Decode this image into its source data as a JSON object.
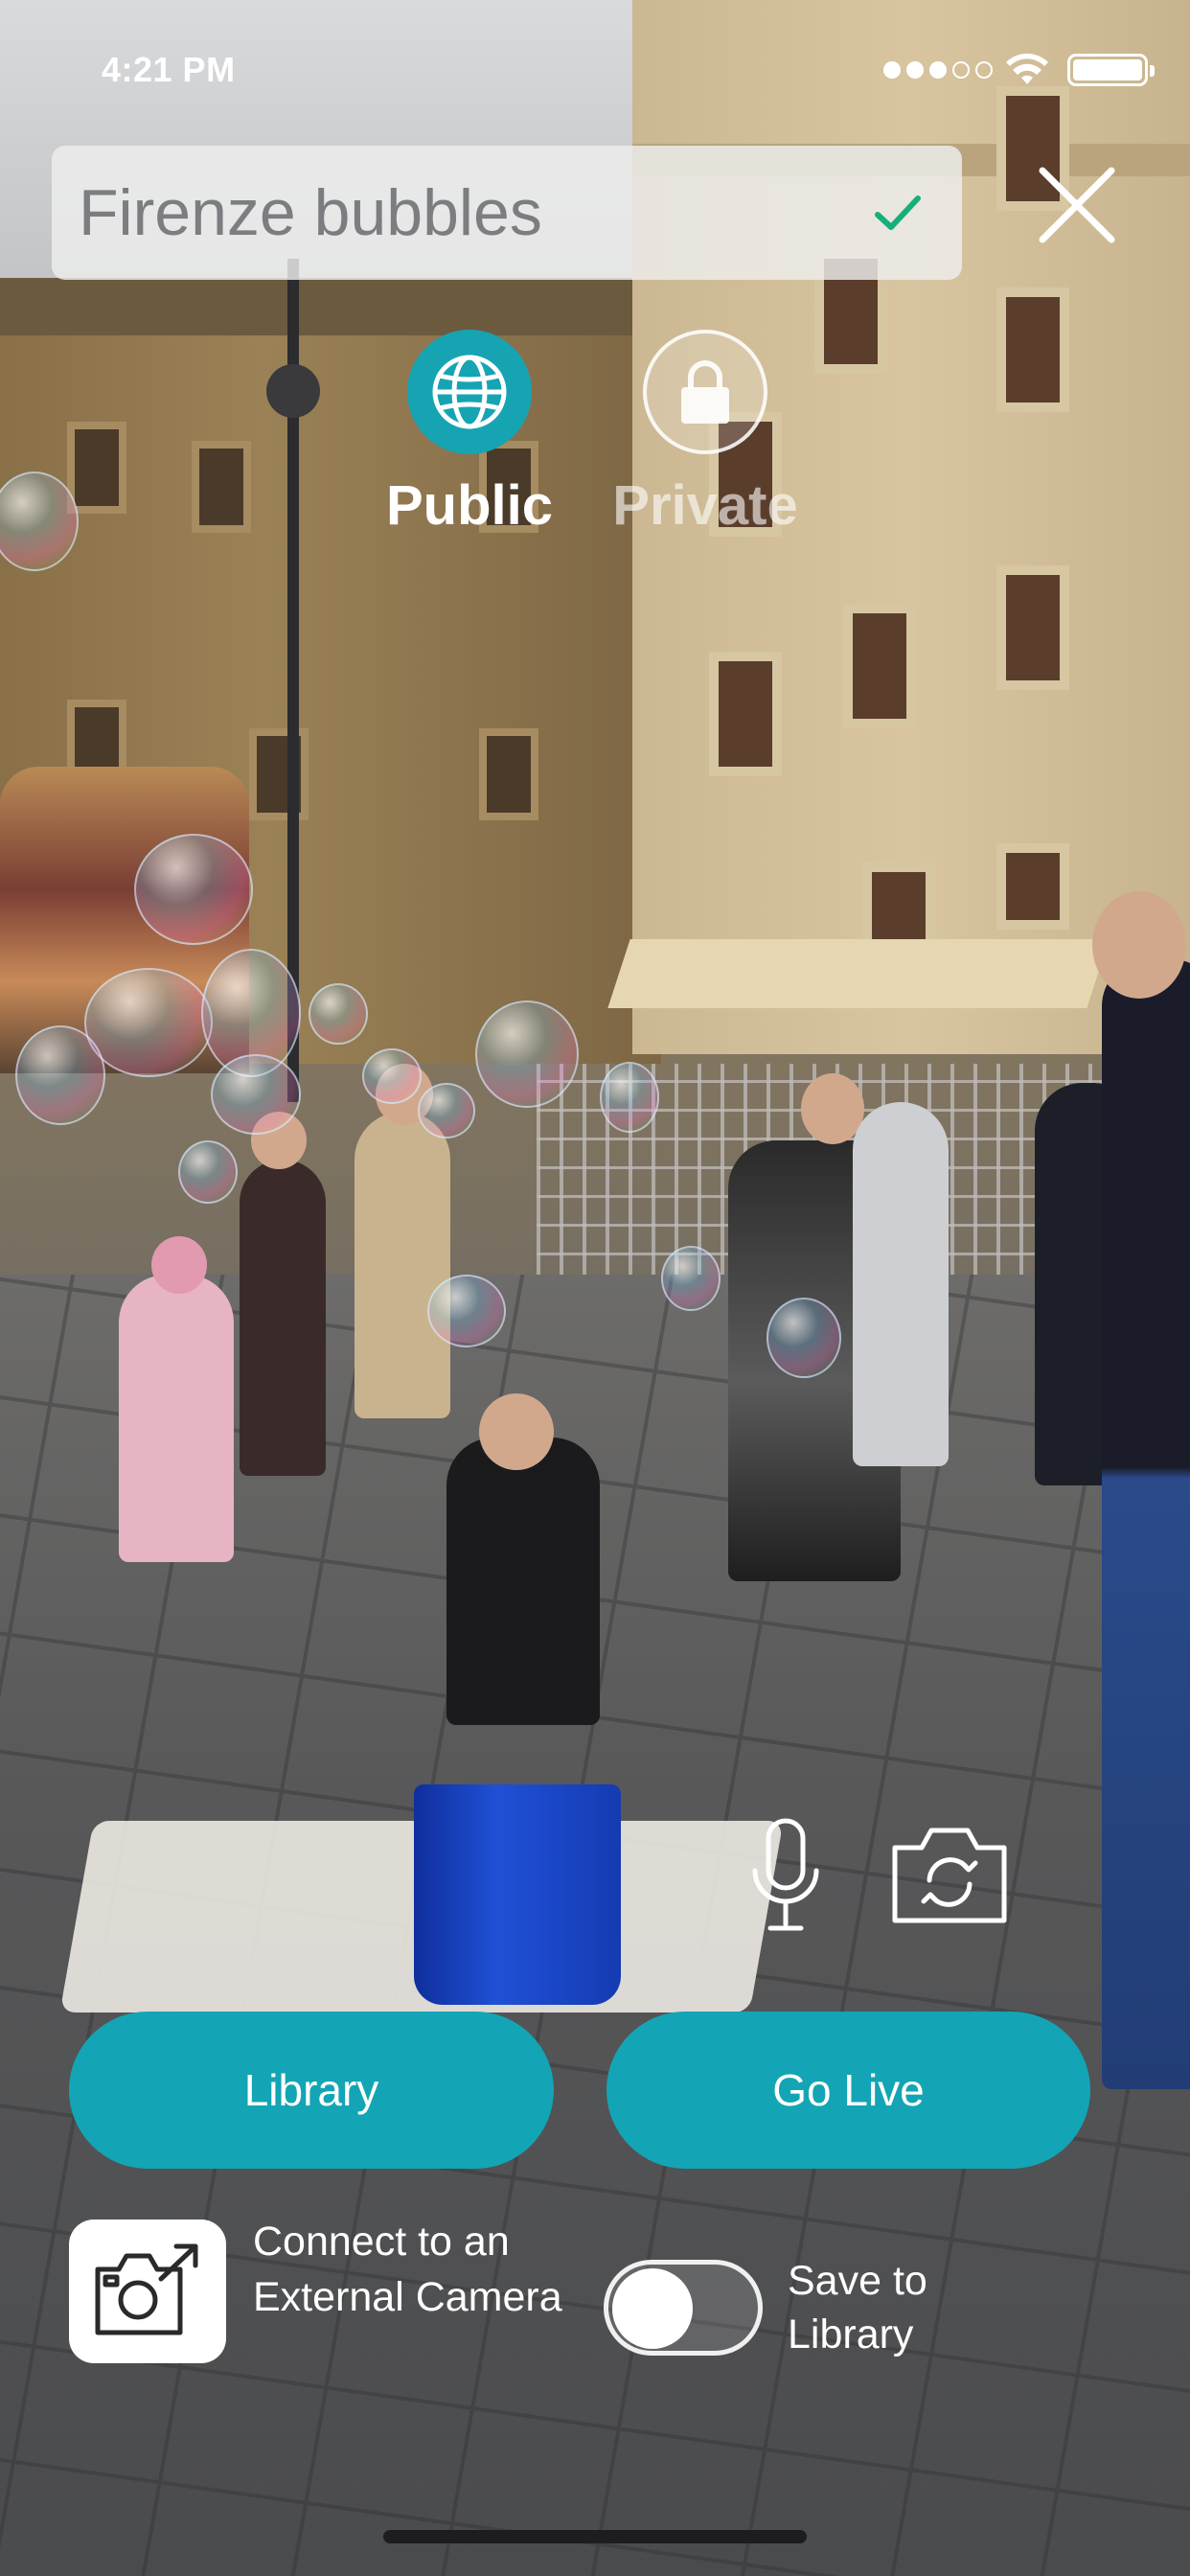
{
  "status_bar": {
    "time": "4:21 PM",
    "signal_filled": 3,
    "signal_total": 5,
    "battery_level": 1.0
  },
  "stream": {
    "title_value": "Firenze bubbles",
    "title_valid": true
  },
  "visibility": {
    "selected": "public",
    "options": [
      {
        "key": "public",
        "label": "Public",
        "icon": "globe-icon"
      },
      {
        "key": "private",
        "label": "Private",
        "icon": "lock-icon"
      }
    ]
  },
  "actions": {
    "library_label": "Library",
    "go_live_label": "Go Live"
  },
  "external_camera": {
    "label": "Connect to an External Camera",
    "icon": "camera-link-icon"
  },
  "save_to_library": {
    "label": "Save to Library",
    "enabled": false
  },
  "colors": {
    "accent": "#13a5b5",
    "check": "#15b07a"
  }
}
